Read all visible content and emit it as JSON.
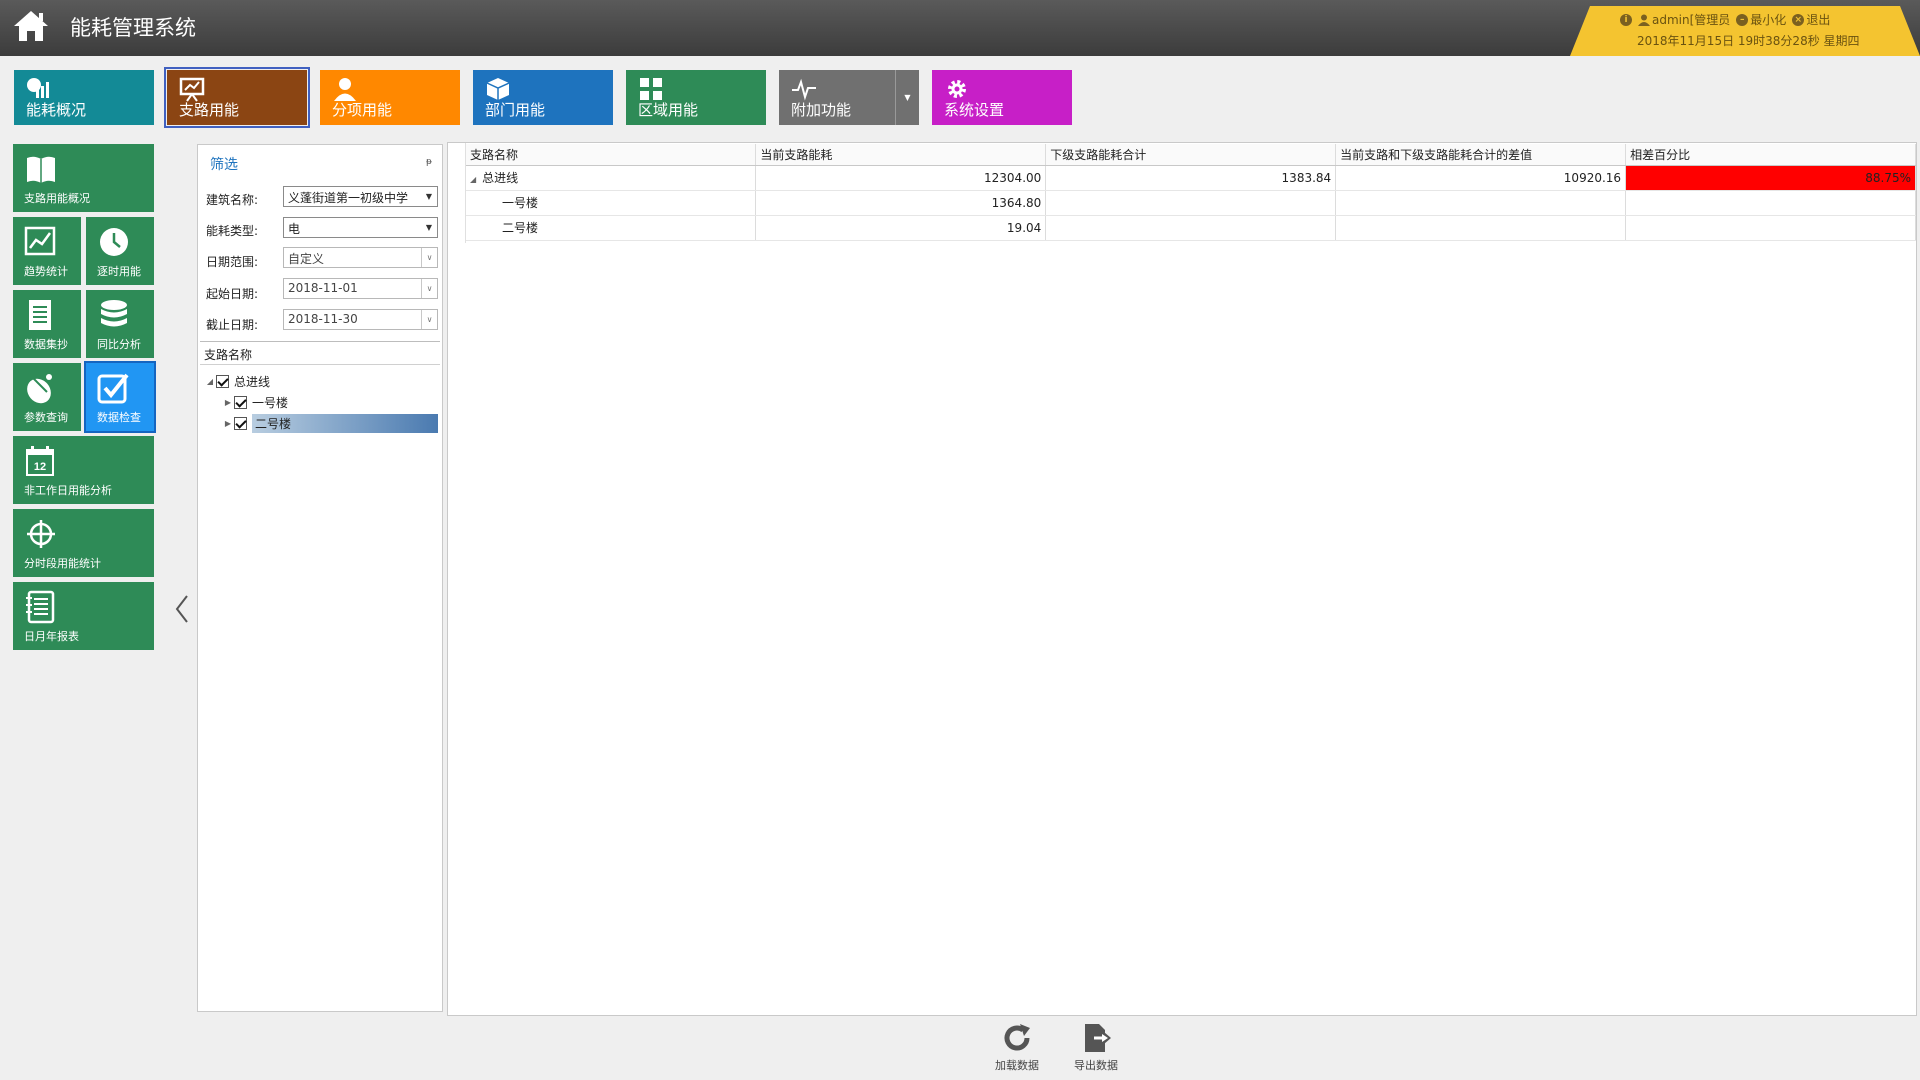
{
  "app": {
    "title": "能耗管理系统"
  },
  "user": {
    "name": "admin[管理员",
    "minimize": "最小化",
    "logout": "退出",
    "datetime": "2018年11月15日  19时38分28秒  星期四"
  },
  "main_tabs": [
    {
      "label": "能耗概况",
      "color": "#138a96",
      "icon": "bar-chart-icon"
    },
    {
      "label": "支路用能",
      "color": "#8b4513",
      "icon": "presentation-icon",
      "active": true
    },
    {
      "label": "分项用能",
      "color": "#ff8800",
      "icon": "user-icon"
    },
    {
      "label": "部门用能",
      "color": "#1e73be",
      "icon": "cube-icon"
    },
    {
      "label": "区域用能",
      "color": "#2e8b57",
      "icon": "grid-icon"
    },
    {
      "label": "附加功能",
      "color": "#707070",
      "icon": "pulse-icon",
      "has_dropdown": true
    },
    {
      "label": "系统设置",
      "color": "#c71fc7",
      "icon": "gear-icon"
    }
  ],
  "side_tiles": [
    {
      "label": "支路用能概况",
      "icon": "book-icon"
    },
    {
      "label": "趋势统计",
      "icon": "trend-chart-icon"
    },
    {
      "label": "逐时用能",
      "icon": "clock-icon"
    },
    {
      "label": "数据集抄",
      "icon": "document-icon"
    },
    {
      "label": "同比分析",
      "icon": "database-icon"
    },
    {
      "label": "参数查询",
      "icon": "satellite-dish-icon"
    },
    {
      "label": "数据检查",
      "icon": "checkbox-icon",
      "active": true
    },
    {
      "label": "非工作日用能分析",
      "icon": "calendar-icon",
      "calendar_day": "12"
    },
    {
      "label": "分时段用能统计",
      "icon": "crosshair-icon"
    },
    {
      "label": "日月年报表",
      "icon": "notebook-icon"
    }
  ],
  "filter": {
    "title": "筛选",
    "pin": "ᵽ",
    "building_label": "建筑名称:",
    "building_value": "义蓬街道第一初级中学",
    "energy_label": "能耗类型:",
    "energy_value": "电",
    "range_label": "日期范围:",
    "range_value": "自定义",
    "start_label": "起始日期:",
    "start_value": "2018-11-01",
    "end_label": "截止日期:",
    "end_value": "2018-11-30",
    "tree_header": "支路名称",
    "tree": [
      {
        "label": "总进线",
        "checked": true,
        "expanded": true
      },
      {
        "label": "一号楼",
        "checked": true
      },
      {
        "label": "二号楼",
        "checked": true,
        "selected": true
      }
    ]
  },
  "grid": {
    "columns": [
      "支路名称",
      "当前支路能耗",
      "下级支路能耗合计",
      "当前支路和下级支路能耗合计的差值",
      "相差百分比"
    ],
    "rows": [
      {
        "name": "总进线",
        "current": "12304.00",
        "sub_total": "1383.84",
        "diff": "10920.16",
        "percent": "88.75%"
      },
      {
        "name": "一号楼",
        "current": "1364.80",
        "sub_total": "",
        "diff": "",
        "percent": ""
      },
      {
        "name": "二号楼",
        "current": "19.04",
        "sub_total": "",
        "diff": "",
        "percent": ""
      }
    ],
    "highlight_color": "#ff0000"
  },
  "bottom_buttons": [
    {
      "label": "加载数据",
      "icon": "reload-icon"
    },
    {
      "label": "导出数据",
      "icon": "export-icon"
    }
  ]
}
